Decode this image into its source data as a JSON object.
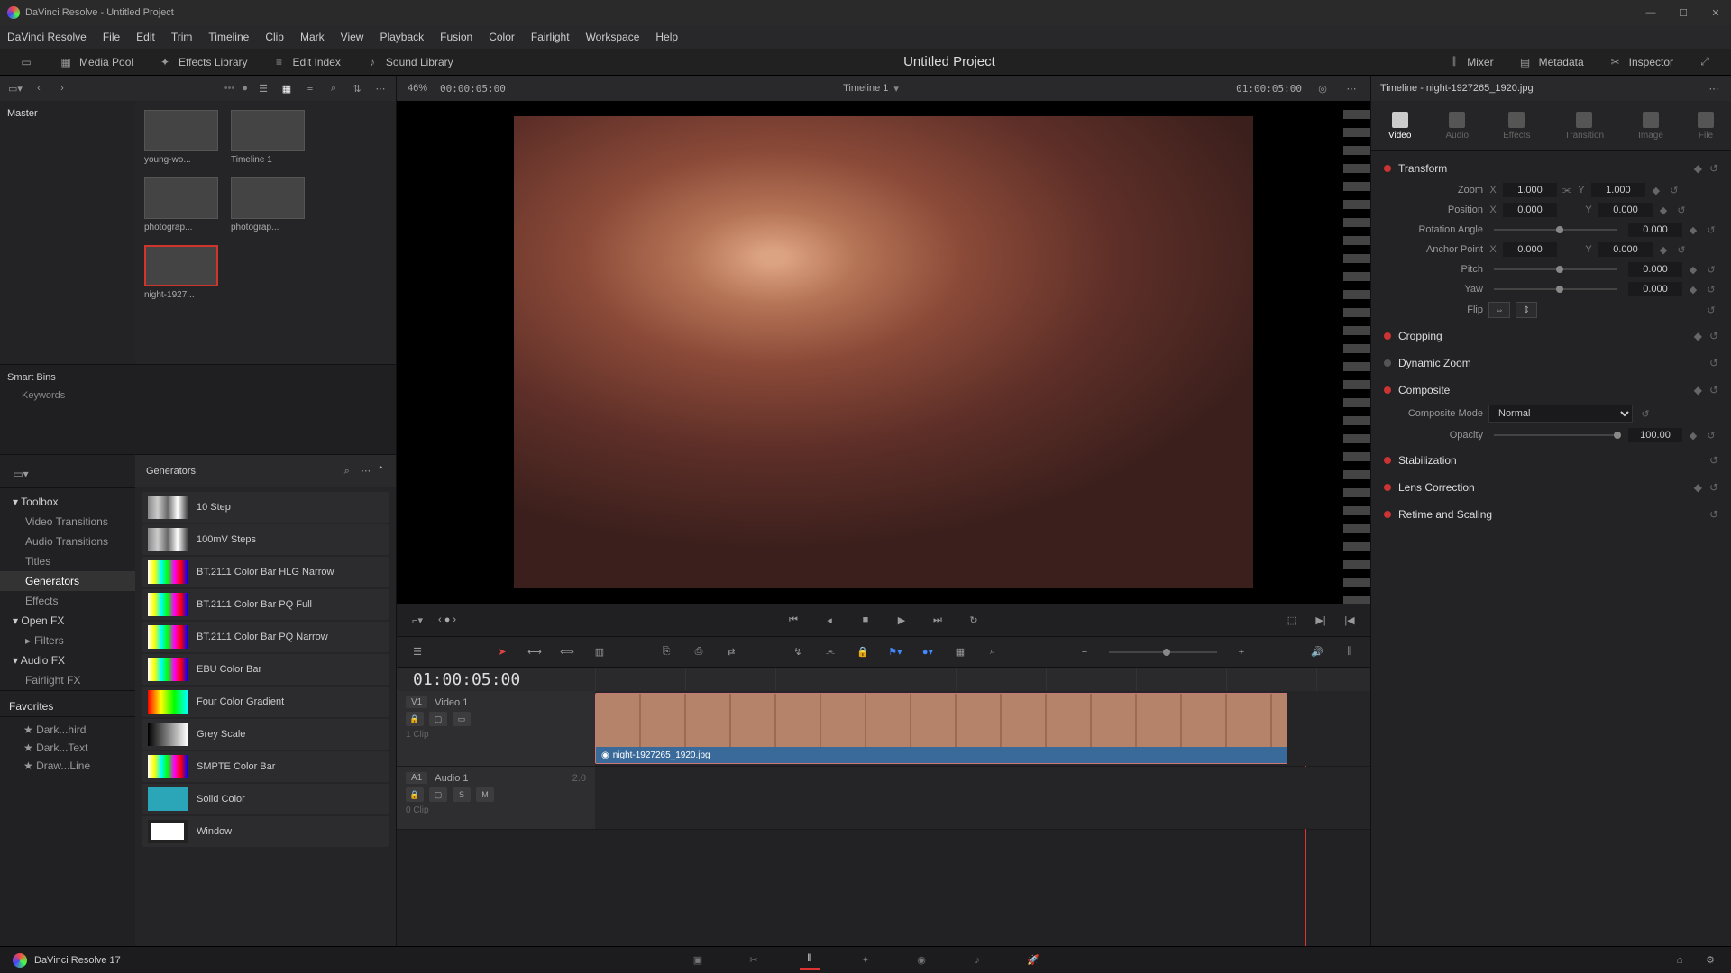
{
  "title": "DaVinci Resolve - Untitled Project",
  "menus": [
    "DaVinci Resolve",
    "File",
    "Edit",
    "Trim",
    "Timeline",
    "Clip",
    "Mark",
    "View",
    "Playback",
    "Fusion",
    "Color",
    "Fairlight",
    "Workspace",
    "Help"
  ],
  "toolbar": {
    "media_pool": "Media Pool",
    "effects_lib": "Effects Library",
    "edit_index": "Edit Index",
    "sound_lib": "Sound Library",
    "project_title": "Untitled Project",
    "mixer": "Mixer",
    "metadata": "Metadata",
    "inspector": "Inspector"
  },
  "subtoolbar": {
    "zoom_pct": "46%",
    "timecode_src": "00:00:05:00",
    "timeline_name": "Timeline 1",
    "timecode_rec": "01:00:05:00",
    "inspector_title": "Timeline - night-1927265_1920.jpg"
  },
  "media": {
    "root": "Master",
    "smartbins": "Smart Bins",
    "keywords": "Keywords",
    "clips": [
      {
        "name": "young-wo...",
        "sel": false
      },
      {
        "name": "Timeline 1",
        "sel": false
      },
      {
        "name": "photograp...",
        "sel": false
      },
      {
        "name": "photograp...",
        "sel": false
      },
      {
        "name": "night-1927...",
        "sel": true
      }
    ]
  },
  "fx": {
    "toolbox": "Toolbox",
    "categories": [
      "Video Transitions",
      "Audio Transitions",
      "Titles",
      "Generators",
      "Effects"
    ],
    "openfx": "Open FX",
    "openfx_sub": [
      "Filters"
    ],
    "audiofx": "Audio FX",
    "audiofx_sub": [
      "Fairlight FX"
    ],
    "selected": "Generators",
    "favorites": "Favorites",
    "fav_items": [
      "Dark...hird",
      "Dark...Text",
      "Draw...Line"
    ],
    "list_header": "Generators",
    "items": [
      {
        "name": "10 Step",
        "sw": "bars"
      },
      {
        "name": "100mV Steps",
        "sw": "bars"
      },
      {
        "name": "BT.2111 Color Bar HLG Narrow",
        "sw": "cbars"
      },
      {
        "name": "BT.2111 Color Bar PQ Full",
        "sw": "cbars"
      },
      {
        "name": "BT.2111 Color Bar PQ Narrow",
        "sw": "cbars"
      },
      {
        "name": "EBU Color Bar",
        "sw": "cbars"
      },
      {
        "name": "Four Color Gradient",
        "sw": "grad"
      },
      {
        "name": "Grey Scale",
        "sw": "grey"
      },
      {
        "name": "SMPTE Color Bar",
        "sw": "cbars"
      },
      {
        "name": "Solid Color",
        "sw": "solid"
      },
      {
        "name": "Window",
        "sw": "win"
      }
    ]
  },
  "timeline": {
    "tc": "01:00:05:00",
    "v1": {
      "tag": "V1",
      "name": "Video 1",
      "clips": "1 Clip"
    },
    "a1": {
      "tag": "A1",
      "name": "Audio 1",
      "ch": "2.0",
      "clips": "0 Clip",
      "s": "S",
      "m": "M"
    },
    "clip_name": "night-1927265_1920.jpg"
  },
  "inspector": {
    "tabs": [
      "Video",
      "Audio",
      "Effects",
      "Transition",
      "Image",
      "File"
    ],
    "active": 0,
    "transform": {
      "title": "Transform",
      "zoom": "Zoom",
      "zoom_x": "1.000",
      "zoom_y": "1.000",
      "position": "Position",
      "pos_x": "0.000",
      "pos_y": "0.000",
      "rotation": "Rotation Angle",
      "rot_v": "0.000",
      "anchor": "Anchor Point",
      "anc_x": "0.000",
      "anc_y": "0.000",
      "pitch": "Pitch",
      "pitch_v": "0.000",
      "yaw": "Yaw",
      "yaw_v": "0.000",
      "flip": "Flip"
    },
    "cropping": "Cropping",
    "dynzoom": "Dynamic Zoom",
    "composite": {
      "title": "Composite",
      "mode_lbl": "Composite Mode",
      "mode": "Normal",
      "opacity_lbl": "Opacity",
      "opacity": "100.00"
    },
    "stabilization": "Stabilization",
    "lens": "Lens Correction",
    "retime": "Retime and Scaling"
  },
  "bottombar": {
    "app": "DaVinci Resolve 17"
  },
  "ax": {
    "x": "X",
    "y": "Y"
  }
}
